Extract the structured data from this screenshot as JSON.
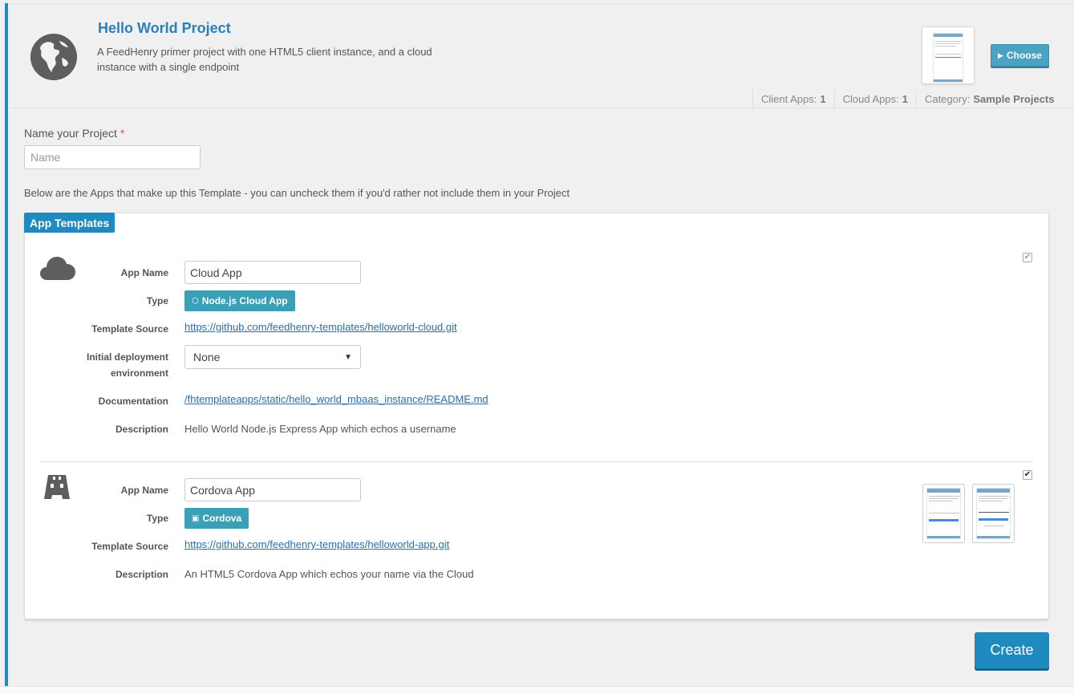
{
  "project": {
    "title": "Hello World Project",
    "description": "A FeedHenry primer project with one HTML5 client instance, and a cloud instance with a single endpoint",
    "choose_label": "Choose",
    "meta": {
      "client_apps_label": "Client Apps:",
      "client_apps_value": "1",
      "cloud_apps_label": "Cloud Apps:",
      "cloud_apps_value": "1",
      "category_label": "Category:",
      "category_value": "Sample Projects"
    }
  },
  "form": {
    "name_label": "Name your Project",
    "required_mark": "*",
    "name_placeholder": "Name",
    "name_value": "",
    "apps_intro": "Below are the Apps that make up this Template - you can uncheck them if you'd rather not include them in your Project"
  },
  "templates": {
    "tab_label": "App Templates",
    "labels": {
      "app_name": "App Name",
      "type": "Type",
      "template_source": "Template Source",
      "initial_env_line1": "Initial deployment",
      "initial_env_line2": "environment",
      "documentation": "Documentation",
      "description": "Description"
    },
    "cloud": {
      "icon": "cloud-icon",
      "app_name": "Cloud App",
      "type": "Node.js Cloud App",
      "template_source": "https://github.com/feedhenry-templates/helloworld-cloud.git",
      "environment": "None",
      "documentation": "/fhtemplateapps/static/hello_world_mbaas_instance/README.md",
      "description": "Hello World Node.js Express App which echos a username",
      "checked": true
    },
    "cordova": {
      "icon": "cordova-icon",
      "app_name": "Cordova App",
      "type": "Cordova",
      "template_source": "https://github.com/feedhenry-templates/helloworld-app.git",
      "description": "An HTML5 Cordova App which echos your name via the Cloud",
      "checked": true
    }
  },
  "actions": {
    "create_label": "Create"
  },
  "colors": {
    "accent": "#1f8ac0",
    "badge": "#3aa0b8",
    "link": "#2a6fa8"
  }
}
